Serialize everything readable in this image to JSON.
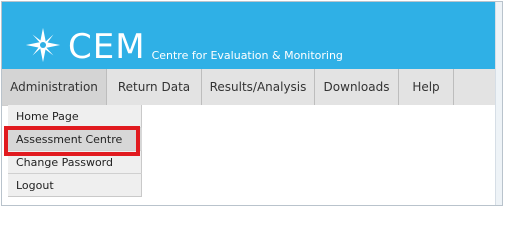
{
  "header": {
    "logo_text": "CEM",
    "org_name": "Centre for Evaluation & Monitoring"
  },
  "nav": {
    "tabs": [
      {
        "label": "Administration"
      },
      {
        "label": "Return Data"
      },
      {
        "label": "Results/Analysis"
      },
      {
        "label": "Downloads"
      },
      {
        "label": "Help"
      }
    ]
  },
  "dropdown": {
    "items": [
      {
        "label": "Home Page"
      },
      {
        "label": "Assessment Centre"
      },
      {
        "label": "Change Password"
      },
      {
        "label": "Logout"
      }
    ]
  },
  "colors": {
    "banner": "#2fb0e6",
    "highlight": "#e11a1f"
  },
  "icons": {
    "logo": "star-burst-icon"
  }
}
